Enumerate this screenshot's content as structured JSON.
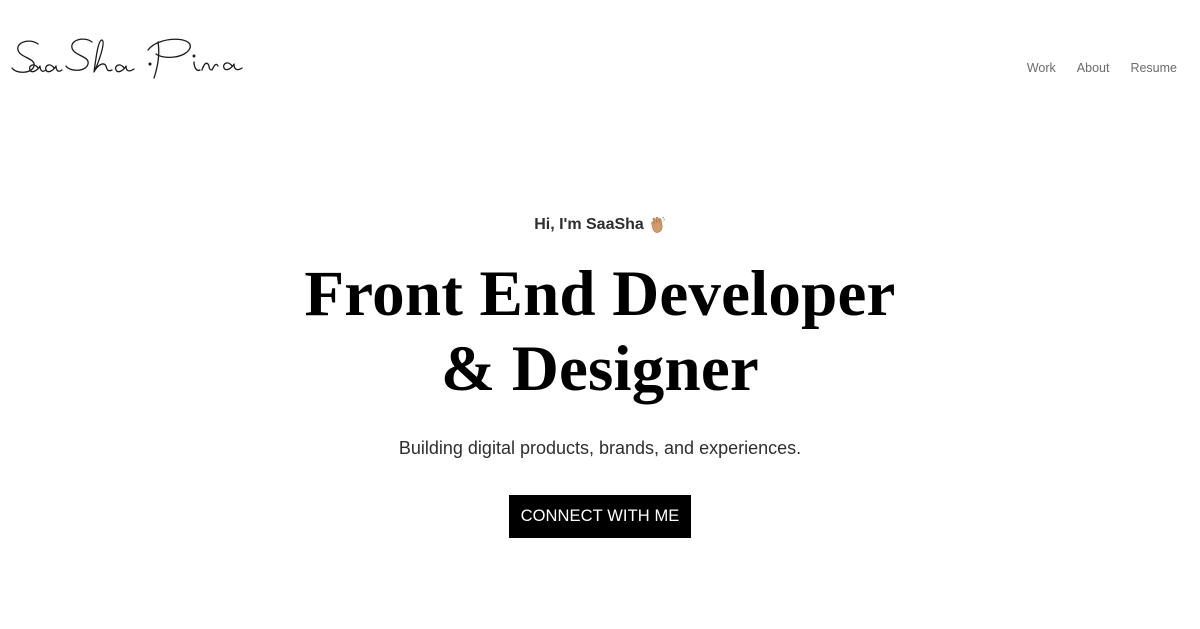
{
  "header": {
    "logo_text": "SaaSha Pina",
    "nav": [
      {
        "label": "Work"
      },
      {
        "label": "About"
      },
      {
        "label": "Resume"
      }
    ]
  },
  "hero": {
    "greeting": "Hi, I'm SaaSha",
    "greeting_icon": "waving-hand-icon",
    "headline_line1": "Front End Developer",
    "headline_line2": "& Designer",
    "subtitle": "Building digital products, brands, and experiences.",
    "cta_label": "CONNECT WITH ME"
  },
  "colors": {
    "background": "#ffffff",
    "text": "#000000",
    "nav_text": "#6b6b6b",
    "cta_background": "#000000",
    "cta_text": "#ffffff"
  }
}
